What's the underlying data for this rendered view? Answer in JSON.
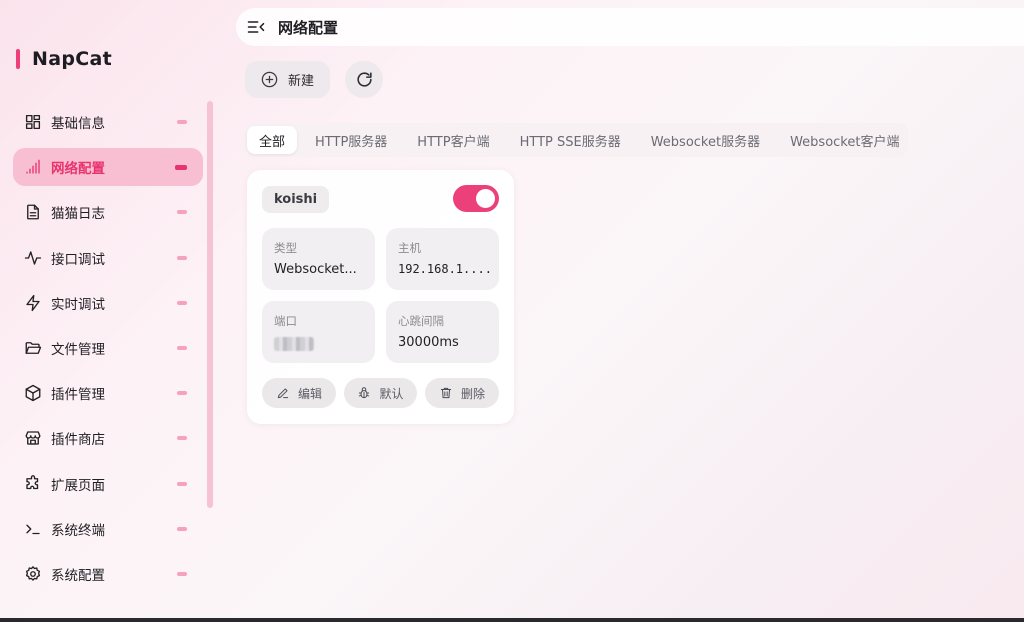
{
  "brand": {
    "name": "NapCat",
    "accent": "#ef3f7a"
  },
  "sidebar": {
    "items": [
      {
        "label": "基础信息",
        "icon": "dashboard-grid-icon",
        "active": false
      },
      {
        "label": "网络配置",
        "icon": "signal-bars-icon",
        "active": true
      },
      {
        "label": "猫猫日志",
        "icon": "document-icon",
        "active": false
      },
      {
        "label": "接口调试",
        "icon": "activity-icon",
        "active": false
      },
      {
        "label": "实时调试",
        "icon": "lightning-icon",
        "active": false
      },
      {
        "label": "文件管理",
        "icon": "folder-icon",
        "active": false
      },
      {
        "label": "插件管理",
        "icon": "package-icon",
        "active": false
      },
      {
        "label": "插件商店",
        "icon": "store-icon",
        "active": false
      },
      {
        "label": "扩展页面",
        "icon": "puzzle-icon",
        "active": false
      },
      {
        "label": "系统终端",
        "icon": "terminal-icon",
        "active": false
      },
      {
        "label": "系统配置",
        "icon": "gear-icon",
        "active": false
      }
    ]
  },
  "header": {
    "title": "网络配置",
    "menu_icon": "collapse-menu-icon"
  },
  "toolbar": {
    "new_label": "新建",
    "new_icon": "plus-circle-icon",
    "refresh_icon": "refresh-icon"
  },
  "tabs": [
    {
      "label": "全部",
      "active": true
    },
    {
      "label": "HTTP服务器",
      "active": false
    },
    {
      "label": "HTTP客户端",
      "active": false
    },
    {
      "label": "HTTP SSE服务器",
      "active": false
    },
    {
      "label": "Websocket服务器",
      "active": false
    },
    {
      "label": "Websocket客户端",
      "active": false
    }
  ],
  "card": {
    "name": "koishi",
    "enabled": true,
    "fields": {
      "type": {
        "label": "类型",
        "value": "Websocket..."
      },
      "host": {
        "label": "主机",
        "value": "192.168.1...."
      },
      "port": {
        "label": "端口",
        "value": ""
      },
      "heartbeat": {
        "label": "心跳间隔",
        "value": "30000ms"
      }
    },
    "actions": {
      "edit": "编辑",
      "default": "默认",
      "delete": "删除"
    }
  },
  "colors": {
    "accent": "#e8336f",
    "toggle_on": "#ec407a",
    "active_nav_bg": "#f8bfd2"
  }
}
